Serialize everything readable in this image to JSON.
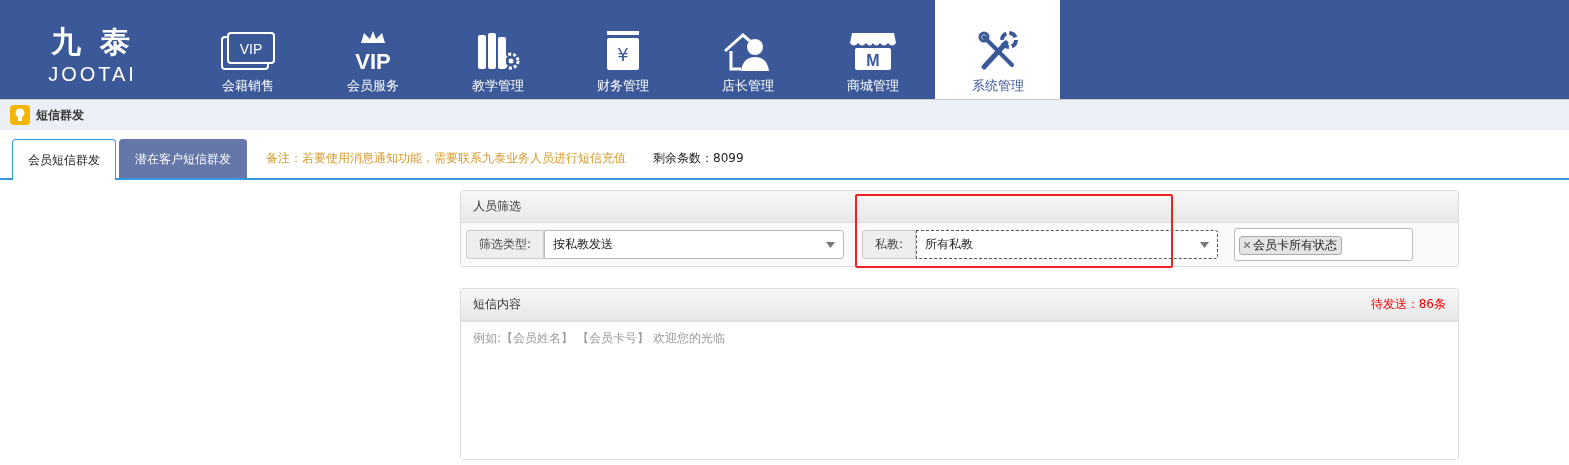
{
  "logo": {
    "mark": "九 泰",
    "name": "JOOTAI"
  },
  "nav": [
    {
      "label": "会籍销售",
      "kind": "card",
      "icon_text": "VIP",
      "selected": false
    },
    {
      "label": "会员服务",
      "kind": "crown",
      "icon_text": "VIP",
      "selected": false
    },
    {
      "label": "教学管理",
      "kind": "books",
      "selected": false
    },
    {
      "label": "财务管理",
      "kind": "money",
      "icon_text": "¥",
      "selected": false
    },
    {
      "label": "店长管理",
      "kind": "manager",
      "selected": false
    },
    {
      "label": "商城管理",
      "kind": "shop",
      "icon_text": "M",
      "selected": false
    },
    {
      "label": "系统管理",
      "kind": "tools",
      "selected": true
    }
  ],
  "breadcrumb": "短信群发",
  "tabs": [
    {
      "label": "会员短信群发",
      "selected": true
    },
    {
      "label": "潜在客户短信群发",
      "selected": false
    }
  ],
  "notice": "备注：若要使用消息通知功能，需要联系九泰业务人员进行短信充值",
  "remaining": "剩余条数：8099",
  "filter": {
    "title": "人员筛选",
    "type_label": "筛选类型:",
    "type_value": "按私教发送",
    "coach_label": "私教:",
    "coach_value": "所有私教",
    "coach_highlighted": true,
    "status_tag": "会员卡所有状态"
  },
  "message": {
    "title": "短信内容",
    "pending": "待发送：86条",
    "placeholder": "例如:【会员姓名】 【会员卡号】 欢迎您的光临"
  }
}
